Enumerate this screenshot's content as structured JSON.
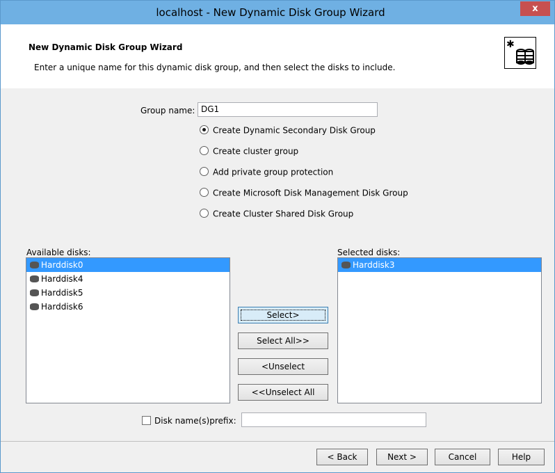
{
  "window": {
    "title": "localhost - New Dynamic Disk Group Wizard",
    "close_label": "x"
  },
  "header": {
    "title": "New Dynamic Disk Group Wizard",
    "description": "Enter a unique name for this dynamic disk group, and then select the disks to include.",
    "icon": "disk-group-icon"
  },
  "group": {
    "label": "Group name:",
    "value": "DG1"
  },
  "options": [
    {
      "label": "Create Dynamic Secondary Disk Group",
      "checked": true
    },
    {
      "label": "Create cluster group",
      "checked": false
    },
    {
      "label": "Add private group protection",
      "checked": false
    },
    {
      "label": "Create Microsoft Disk Management Disk Group",
      "checked": false
    },
    {
      "label": "Create Cluster Shared Disk Group",
      "checked": false
    }
  ],
  "available": {
    "label": "Available disks:",
    "items": [
      {
        "name": "Harddisk0",
        "selected": true
      },
      {
        "name": "Harddisk4",
        "selected": false
      },
      {
        "name": "Harddisk5",
        "selected": false
      },
      {
        "name": "Harddisk6",
        "selected": false
      }
    ]
  },
  "selected": {
    "label": "Selected disks:",
    "items": [
      {
        "name": "Harddisk3",
        "selected": true
      }
    ]
  },
  "actions": {
    "select": "Select>",
    "select_all": "Select All>>",
    "unselect": "<Unselect",
    "unselect_all": "<<Unselect All"
  },
  "prefix": {
    "label": "Disk name(s)prefix:",
    "checked": false,
    "value": ""
  },
  "footer": {
    "back": "< Back",
    "next": "Next >",
    "cancel": "Cancel",
    "help": "Help"
  },
  "colors": {
    "titlebar": "#6fb0e3",
    "selection": "#3399ff",
    "close": "#c75050"
  }
}
